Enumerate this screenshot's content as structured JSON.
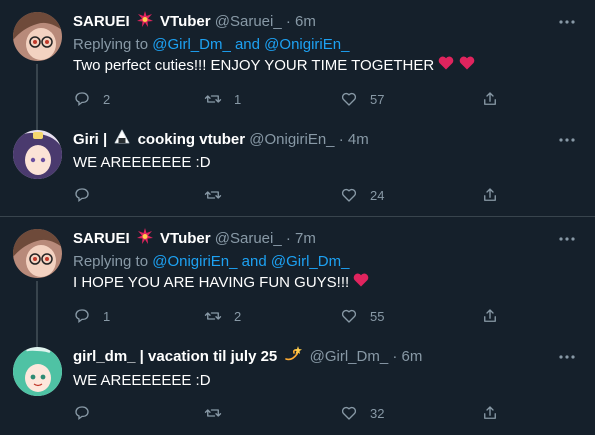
{
  "tweets": [
    {
      "name": "SARUEI",
      "name_suffix": "VTuber",
      "handle": "@Saruei_",
      "separator": "·",
      "time": "6m",
      "replying_prefix": "Replying to",
      "mention1": "@Girl_Dm_",
      "mention_join": "and",
      "mention2": "@OnigiriEn_",
      "text": "Two perfect cuties!!! ENJOY YOUR TIME TOGETHER",
      "replies": "2",
      "retweets": "1",
      "likes": "57",
      "emoji_icon": "explosion-icon"
    },
    {
      "name": "Giri |",
      "name_suffix": "cooking vtuber",
      "handle": "@OnigiriEn_",
      "separator": "·",
      "time": "4m",
      "text": "WE AREEEEEEE :D",
      "replies": "",
      "retweets": "",
      "likes": "24",
      "emoji_icon": "rice-ball-icon"
    },
    {
      "name": "SARUEI",
      "name_suffix": "VTuber",
      "handle": "@Saruei_",
      "separator": "·",
      "time": "7m",
      "replying_prefix": "Replying to",
      "mention1": "@OnigiriEn_",
      "mention_join": "and",
      "mention2": "@Girl_Dm_",
      "text": "I HOPE YOU ARE HAVING FUN GUYS!!!",
      "replies": "1",
      "retweets": "2",
      "likes": "55",
      "emoji_icon": "explosion-icon"
    },
    {
      "name": "girl_dm_ | vacation til july 25",
      "handle": "@Girl_Dm_",
      "separator": "·",
      "time": "6m",
      "text": "WE AREEEEEEE :D",
      "replies": "",
      "retweets": "",
      "likes": "32",
      "emoji_icon": "dizzy-icon"
    }
  ],
  "colors": {
    "background": "#15202b",
    "secondary_text": "#8899a6",
    "mention": "#1da1f2",
    "heart": "#e0245e",
    "divider": "#38444d"
  }
}
